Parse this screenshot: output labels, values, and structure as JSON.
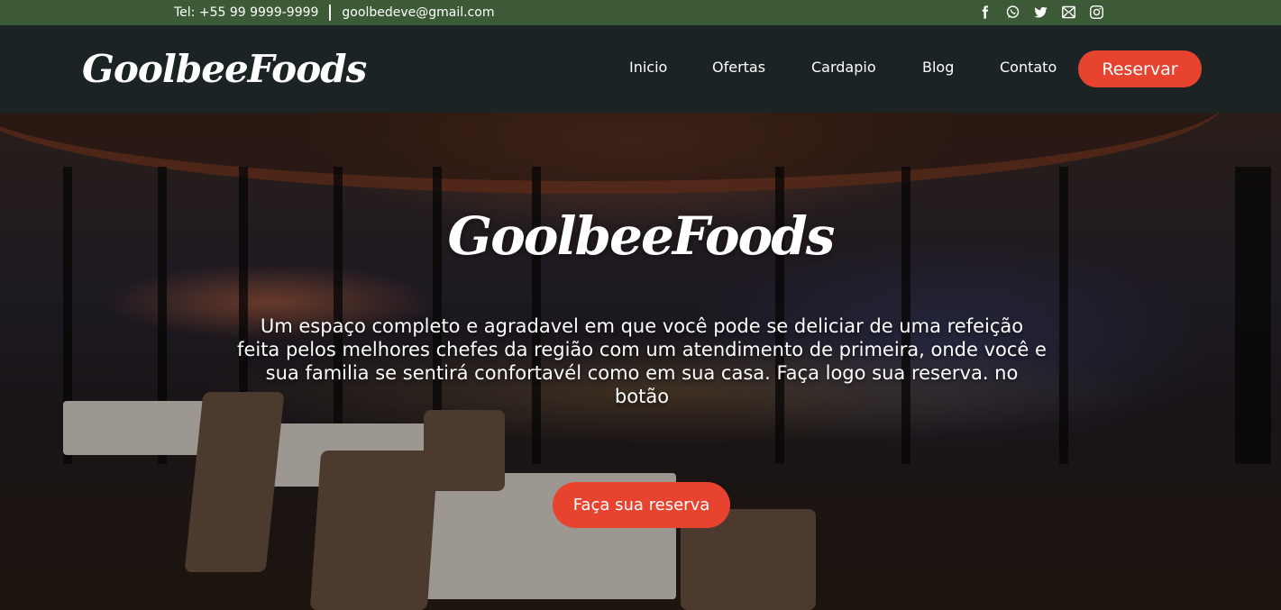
{
  "topbar": {
    "phone": "Tel: +55 99 9999-9999",
    "email": "goolbedeve@gmail.com",
    "socials": [
      "facebook-icon",
      "whatsapp-icon",
      "twitter-icon",
      "mail-icon",
      "instagram-icon"
    ]
  },
  "header": {
    "logo": "GoolbeeFoods",
    "nav": [
      "Inicio",
      "Ofertas",
      "Cardapio",
      "Blog",
      "Contato"
    ],
    "reserve_label": "Reservar"
  },
  "hero": {
    "title": "GoolbeeFoods",
    "description": "Um espaço completo e agradavel em que você pode se deliciar de uma refeição feita pelos melhores chefes da região com um atendimento de primeira, onde você e sua familia se sentirá confortavél como em sua casa. Faça logo sua reserva. no botão",
    "cta_label": "Faça sua reserva"
  },
  "colors": {
    "topbar": "#3d5a36",
    "header": "#1b2324",
    "accent": "#e8432f"
  }
}
